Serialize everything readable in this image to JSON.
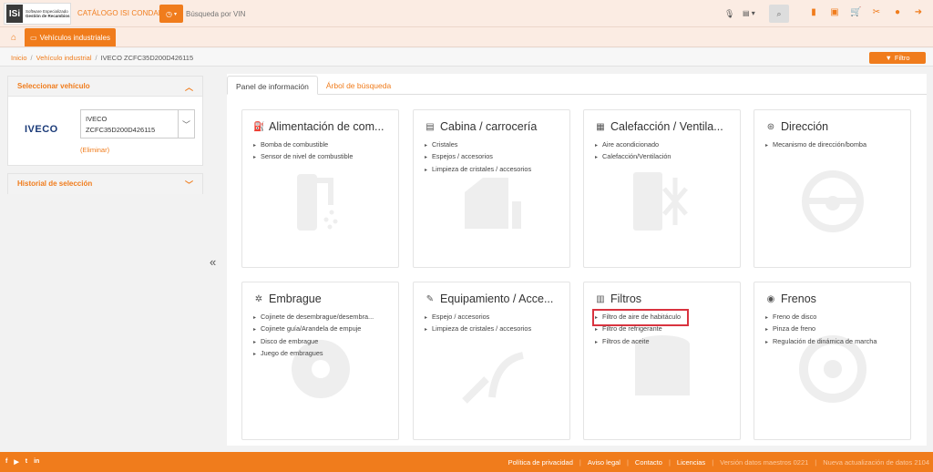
{
  "header": {
    "logo_mark": "ISi",
    "logo_line1": "Software Especializado",
    "logo_line2": "Gestión de Recambios",
    "catalog_title": "CATÁLOGO ISI CONDAL",
    "search_placeholder": "Búsqueda por VIN",
    "icons": [
      "document-icon",
      "catalog-icon",
      "cart-icon",
      "tools-icon",
      "user-icon",
      "logout-icon"
    ]
  },
  "nav": {
    "vehicle_tab": "Vehículos industriales"
  },
  "breadcrumb": {
    "home": "Inicio",
    "category": "Vehículo industrial",
    "current": "IVECO ZCFC35D200D426115"
  },
  "filter_button": "Filtro",
  "sidebar": {
    "select_title": "Seleccionar vehículo",
    "brand": "IVECO",
    "vehicle_line1": "IVECO",
    "vehicle_line2": "ZCFC35D200D426115",
    "remove": "(Eliminar)",
    "history_title": "Historial de selección"
  },
  "tabs": [
    "Panel de información",
    "Árbol de búsqueda"
  ],
  "cards": [
    {
      "title": "Alimentación de com...",
      "icon": "fuel-icon",
      "items": [
        "Bomba de combustible",
        "Sensor de nivel de combustible"
      ]
    },
    {
      "title": "Cabina / carrocería",
      "icon": "cabin-icon",
      "items": [
        "Cristales",
        "Espejos / accesorios",
        "Limpieza de cristales / accesorios"
      ]
    },
    {
      "title": "Calefacción / Ventila...",
      "icon": "heating-icon",
      "items": [
        "Aire acondicionado",
        "Calefacción/Ventilación"
      ]
    },
    {
      "title": "Dirección",
      "icon": "steering-icon",
      "items": [
        "Mecanismo de dirección/bomba"
      ]
    },
    {
      "title": "Embrague",
      "icon": "clutch-icon",
      "items": [
        "Cojinete de desembrague/desembra...",
        "Cojinete guía/Arandela de empuje",
        "Disco de embrague",
        "Juego de embragues"
      ]
    },
    {
      "title": "Equipamiento / Acce...",
      "icon": "equipment-icon",
      "items": [
        "Espejo / accesorios",
        "Limpieza de cristales / accesorios"
      ]
    },
    {
      "title": "Filtros",
      "icon": "filter-icon",
      "items": [
        "Filtro de aire de habitáculo",
        "Filtro de refrigerante",
        "Filtros de aceite"
      ],
      "highlighted": 0
    },
    {
      "title": "Frenos",
      "icon": "brake-icon",
      "items": [
        "Freno de disco",
        "Pinza de freno",
        "Regulación de dinámica de marcha"
      ]
    }
  ],
  "footer": {
    "social": [
      "f",
      "▶",
      "t",
      "in"
    ],
    "links": [
      "Política de privacidad",
      "Aviso legal",
      "Contacto",
      "Licencias"
    ],
    "master_data": "Versión datos maestros 0221",
    "update": "Nueva actualización de datos 2104"
  }
}
